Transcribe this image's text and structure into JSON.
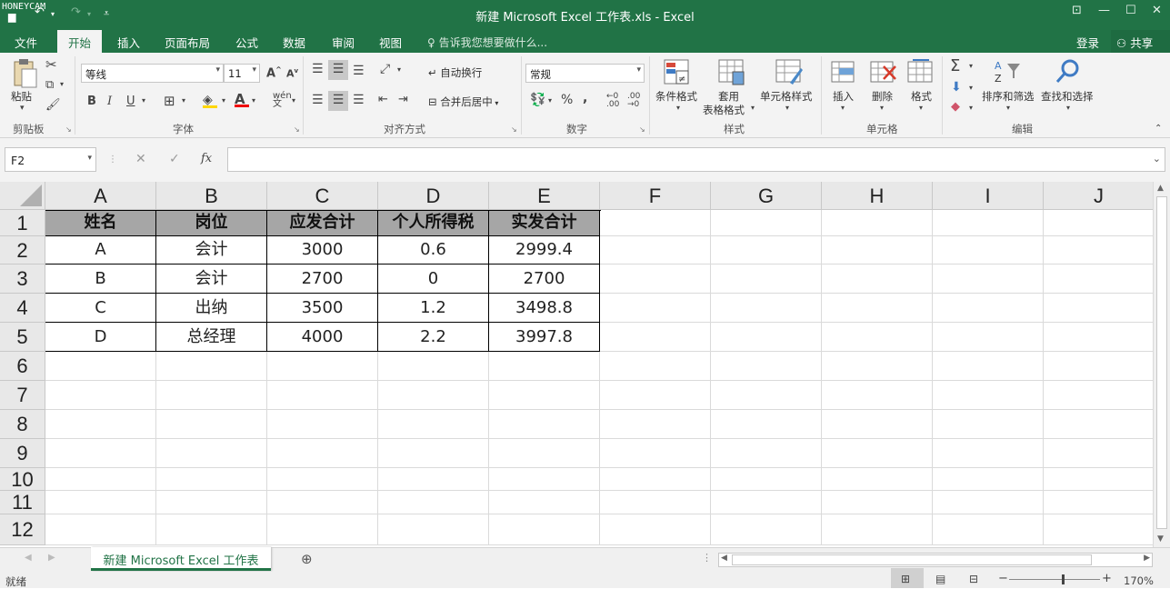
{
  "watermark": "HONEYCAM",
  "window": {
    "title": "新建 Microsoft Excel 工作表.xls - Excel"
  },
  "menu": {
    "tabs": [
      "文件",
      "开始",
      "插入",
      "页面布局",
      "公式",
      "数据",
      "审阅",
      "视图"
    ],
    "active_tab": "开始",
    "tell_me": "告诉我您想要做什么...",
    "login": "登录",
    "share": "共享"
  },
  "ribbon": {
    "clipboard": {
      "paste": "粘贴",
      "group": "剪贴板"
    },
    "font": {
      "name": "等线",
      "size": "11",
      "group": "字体"
    },
    "alignment": {
      "wrap": "自动换行",
      "merge": "合并后居中",
      "group": "对齐方式"
    },
    "number": {
      "format": "常规",
      "group": "数字"
    },
    "styles": {
      "conditional": "条件格式",
      "table1": "套用",
      "table2": "表格格式",
      "cell_styles": "单元格样式",
      "group": "样式"
    },
    "cells": {
      "insert": "插入",
      "delete": "删除",
      "format": "格式",
      "group": "单元格"
    },
    "editing": {
      "sort": "排序和筛选",
      "find": "查找和选择",
      "group": "编辑"
    }
  },
  "formula_bar": {
    "name_box": "F2",
    "fx": "fx",
    "content": ""
  },
  "sheet": {
    "columns": [
      "A",
      "B",
      "C",
      "D",
      "E",
      "F",
      "G",
      "H",
      "I",
      "J"
    ],
    "rows": [
      "1",
      "2",
      "3",
      "4",
      "5",
      "6",
      "7",
      "8",
      "9",
      "10",
      "11",
      "12"
    ],
    "table": [
      [
        "姓名",
        "岗位",
        "应发合计",
        "个人所得税",
        "实发合计"
      ],
      [
        "A",
        "会计",
        "3000",
        "0.6",
        "2999.4"
      ],
      [
        "B",
        "会计",
        "2700",
        "0",
        "2700"
      ],
      [
        "C",
        "出纳",
        "3500",
        "1.2",
        "3498.8"
      ],
      [
        "D",
        "总经理",
        "4000",
        "2.2",
        "3997.8"
      ]
    ]
  },
  "sheet_tab": "新建 Microsoft Excel 工作表",
  "status": {
    "ready": "就绪",
    "zoom": "170%"
  },
  "colors": {
    "accent": "#217346",
    "header_fill": "#a6a6a6"
  }
}
